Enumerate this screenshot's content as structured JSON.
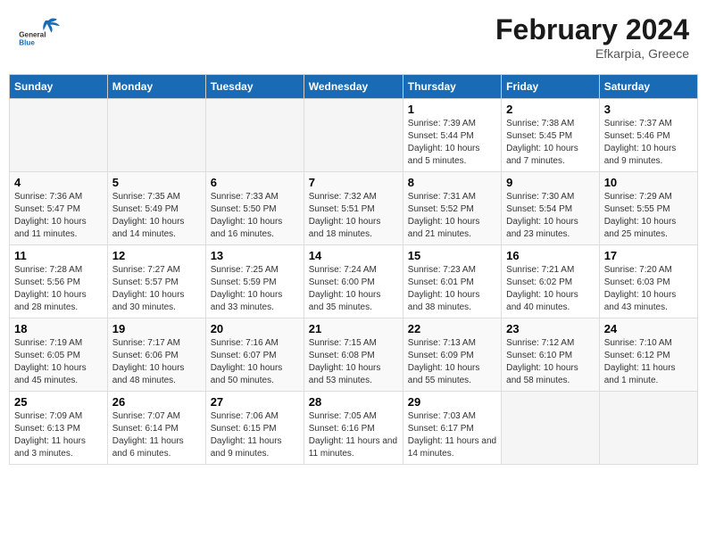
{
  "header": {
    "title": "February 2024",
    "subtitle": "Efkarpia, Greece",
    "logo_general": "General",
    "logo_blue": "Blue"
  },
  "columns": [
    "Sunday",
    "Monday",
    "Tuesday",
    "Wednesday",
    "Thursday",
    "Friday",
    "Saturday"
  ],
  "weeks": [
    [
      {
        "day": "",
        "info": ""
      },
      {
        "day": "",
        "info": ""
      },
      {
        "day": "",
        "info": ""
      },
      {
        "day": "",
        "info": ""
      },
      {
        "day": "1",
        "info": "Sunrise: 7:39 AM\nSunset: 5:44 PM\nDaylight: 10 hours\nand 5 minutes."
      },
      {
        "day": "2",
        "info": "Sunrise: 7:38 AM\nSunset: 5:45 PM\nDaylight: 10 hours\nand 7 minutes."
      },
      {
        "day": "3",
        "info": "Sunrise: 7:37 AM\nSunset: 5:46 PM\nDaylight: 10 hours\nand 9 minutes."
      }
    ],
    [
      {
        "day": "4",
        "info": "Sunrise: 7:36 AM\nSunset: 5:47 PM\nDaylight: 10 hours\nand 11 minutes."
      },
      {
        "day": "5",
        "info": "Sunrise: 7:35 AM\nSunset: 5:49 PM\nDaylight: 10 hours\nand 14 minutes."
      },
      {
        "day": "6",
        "info": "Sunrise: 7:33 AM\nSunset: 5:50 PM\nDaylight: 10 hours\nand 16 minutes."
      },
      {
        "day": "7",
        "info": "Sunrise: 7:32 AM\nSunset: 5:51 PM\nDaylight: 10 hours\nand 18 minutes."
      },
      {
        "day": "8",
        "info": "Sunrise: 7:31 AM\nSunset: 5:52 PM\nDaylight: 10 hours\nand 21 minutes."
      },
      {
        "day": "9",
        "info": "Sunrise: 7:30 AM\nSunset: 5:54 PM\nDaylight: 10 hours\nand 23 minutes."
      },
      {
        "day": "10",
        "info": "Sunrise: 7:29 AM\nSunset: 5:55 PM\nDaylight: 10 hours\nand 25 minutes."
      }
    ],
    [
      {
        "day": "11",
        "info": "Sunrise: 7:28 AM\nSunset: 5:56 PM\nDaylight: 10 hours\nand 28 minutes."
      },
      {
        "day": "12",
        "info": "Sunrise: 7:27 AM\nSunset: 5:57 PM\nDaylight: 10 hours\nand 30 minutes."
      },
      {
        "day": "13",
        "info": "Sunrise: 7:25 AM\nSunset: 5:59 PM\nDaylight: 10 hours\nand 33 minutes."
      },
      {
        "day": "14",
        "info": "Sunrise: 7:24 AM\nSunset: 6:00 PM\nDaylight: 10 hours\nand 35 minutes."
      },
      {
        "day": "15",
        "info": "Sunrise: 7:23 AM\nSunset: 6:01 PM\nDaylight: 10 hours\nand 38 minutes."
      },
      {
        "day": "16",
        "info": "Sunrise: 7:21 AM\nSunset: 6:02 PM\nDaylight: 10 hours\nand 40 minutes."
      },
      {
        "day": "17",
        "info": "Sunrise: 7:20 AM\nSunset: 6:03 PM\nDaylight: 10 hours\nand 43 minutes."
      }
    ],
    [
      {
        "day": "18",
        "info": "Sunrise: 7:19 AM\nSunset: 6:05 PM\nDaylight: 10 hours\nand 45 minutes."
      },
      {
        "day": "19",
        "info": "Sunrise: 7:17 AM\nSunset: 6:06 PM\nDaylight: 10 hours\nand 48 minutes."
      },
      {
        "day": "20",
        "info": "Sunrise: 7:16 AM\nSunset: 6:07 PM\nDaylight: 10 hours\nand 50 minutes."
      },
      {
        "day": "21",
        "info": "Sunrise: 7:15 AM\nSunset: 6:08 PM\nDaylight: 10 hours\nand 53 minutes."
      },
      {
        "day": "22",
        "info": "Sunrise: 7:13 AM\nSunset: 6:09 PM\nDaylight: 10 hours\nand 55 minutes."
      },
      {
        "day": "23",
        "info": "Sunrise: 7:12 AM\nSunset: 6:10 PM\nDaylight: 10 hours\nand 58 minutes."
      },
      {
        "day": "24",
        "info": "Sunrise: 7:10 AM\nSunset: 6:12 PM\nDaylight: 11 hours\nand 1 minute."
      }
    ],
    [
      {
        "day": "25",
        "info": "Sunrise: 7:09 AM\nSunset: 6:13 PM\nDaylight: 11 hours\nand 3 minutes."
      },
      {
        "day": "26",
        "info": "Sunrise: 7:07 AM\nSunset: 6:14 PM\nDaylight: 11 hours\nand 6 minutes."
      },
      {
        "day": "27",
        "info": "Sunrise: 7:06 AM\nSunset: 6:15 PM\nDaylight: 11 hours\nand 9 minutes."
      },
      {
        "day": "28",
        "info": "Sunrise: 7:05 AM\nSunset: 6:16 PM\nDaylight: 11 hours\nand 11 minutes."
      },
      {
        "day": "29",
        "info": "Sunrise: 7:03 AM\nSunset: 6:17 PM\nDaylight: 11 hours\nand 14 minutes."
      },
      {
        "day": "",
        "info": ""
      },
      {
        "day": "",
        "info": ""
      }
    ]
  ]
}
